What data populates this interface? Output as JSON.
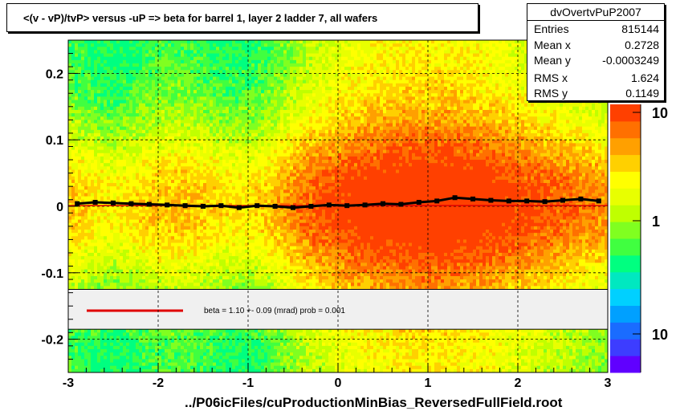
{
  "title": "<(v - vP)/tvP>  versus  -uP => beta for barrel 1, layer 2 ladder 7, all wafers",
  "stats": {
    "name": "dvOvertvPuP2007",
    "rows": [
      {
        "label": "Entries",
        "value": "815144"
      },
      {
        "label": "Mean x",
        "value": "0.2728"
      },
      {
        "label": "Mean y",
        "value": "-0.0003249"
      },
      {
        "label": "RMS x",
        "value": "1.624"
      },
      {
        "label": "RMS y",
        "value": "0.1149"
      }
    ]
  },
  "fit_legend": {
    "text": "beta =    1.10 +-  0.09 (mrad) prob = 0.001",
    "line_color": "#e00000"
  },
  "footer": "../P06icFiles/cuProductionMinBias_ReversedFullField.root",
  "chart_data": {
    "type": "heatmap",
    "xlim": [
      -3,
      3
    ],
    "ylim": [
      -0.25,
      0.25
    ],
    "x_ticks": [
      -3,
      -2,
      -1,
      0,
      1,
      2,
      3
    ],
    "y_ticks": [
      -0.2,
      -0.1,
      0,
      0.1,
      0.2
    ],
    "x_tick_labels": [
      "-3",
      "-2",
      "-1",
      "0",
      "1",
      "2",
      "3"
    ],
    "y_tick_labels": [
      "-0.2",
      "-0.1",
      "0",
      "0.1",
      "0.2"
    ],
    "grid": true,
    "color_scale": {
      "log": true,
      "labels": [
        "10",
        "1",
        "10"
      ],
      "colors": [
        "#6000ff",
        "#3d3dff",
        "#1a6cff",
        "#00a0ff",
        "#00d0ff",
        "#00e8c0",
        "#00ff80",
        "#40ff40",
        "#80ff20",
        "#c0ff00",
        "#e8ff00",
        "#ffff00",
        "#ffd000",
        "#ffa000",
        "#ff7000",
        "#ff4000"
      ]
    },
    "profile": {
      "name": "profile",
      "x": [
        -2.9,
        -2.7,
        -2.5,
        -2.3,
        -2.1,
        -1.9,
        -1.7,
        -1.5,
        -1.3,
        -1.1,
        -0.9,
        -0.7,
        -0.5,
        -0.3,
        -0.1,
        0.1,
        0.3,
        0.5,
        0.7,
        0.9,
        1.1,
        1.3,
        1.5,
        1.7,
        1.9,
        2.1,
        2.3,
        2.5,
        2.7,
        2.9
      ],
      "y": [
        0.004,
        0.006,
        0.005,
        0.004,
        0.003,
        0.002,
        0.001,
        0.0,
        0.001,
        -0.002,
        0.001,
        0.0,
        -0.002,
        0.0,
        0.002,
        0.001,
        0.002,
        0.004,
        0.003,
        0.006,
        0.008,
        0.013,
        0.011,
        0.009,
        0.008,
        0.008,
        0.007,
        0.009,
        0.011,
        0.008
      ]
    },
    "fit_line": {
      "x": [
        -3,
        3
      ],
      "y": [
        0.001,
        0.001
      ],
      "color": "#e00000"
    }
  }
}
